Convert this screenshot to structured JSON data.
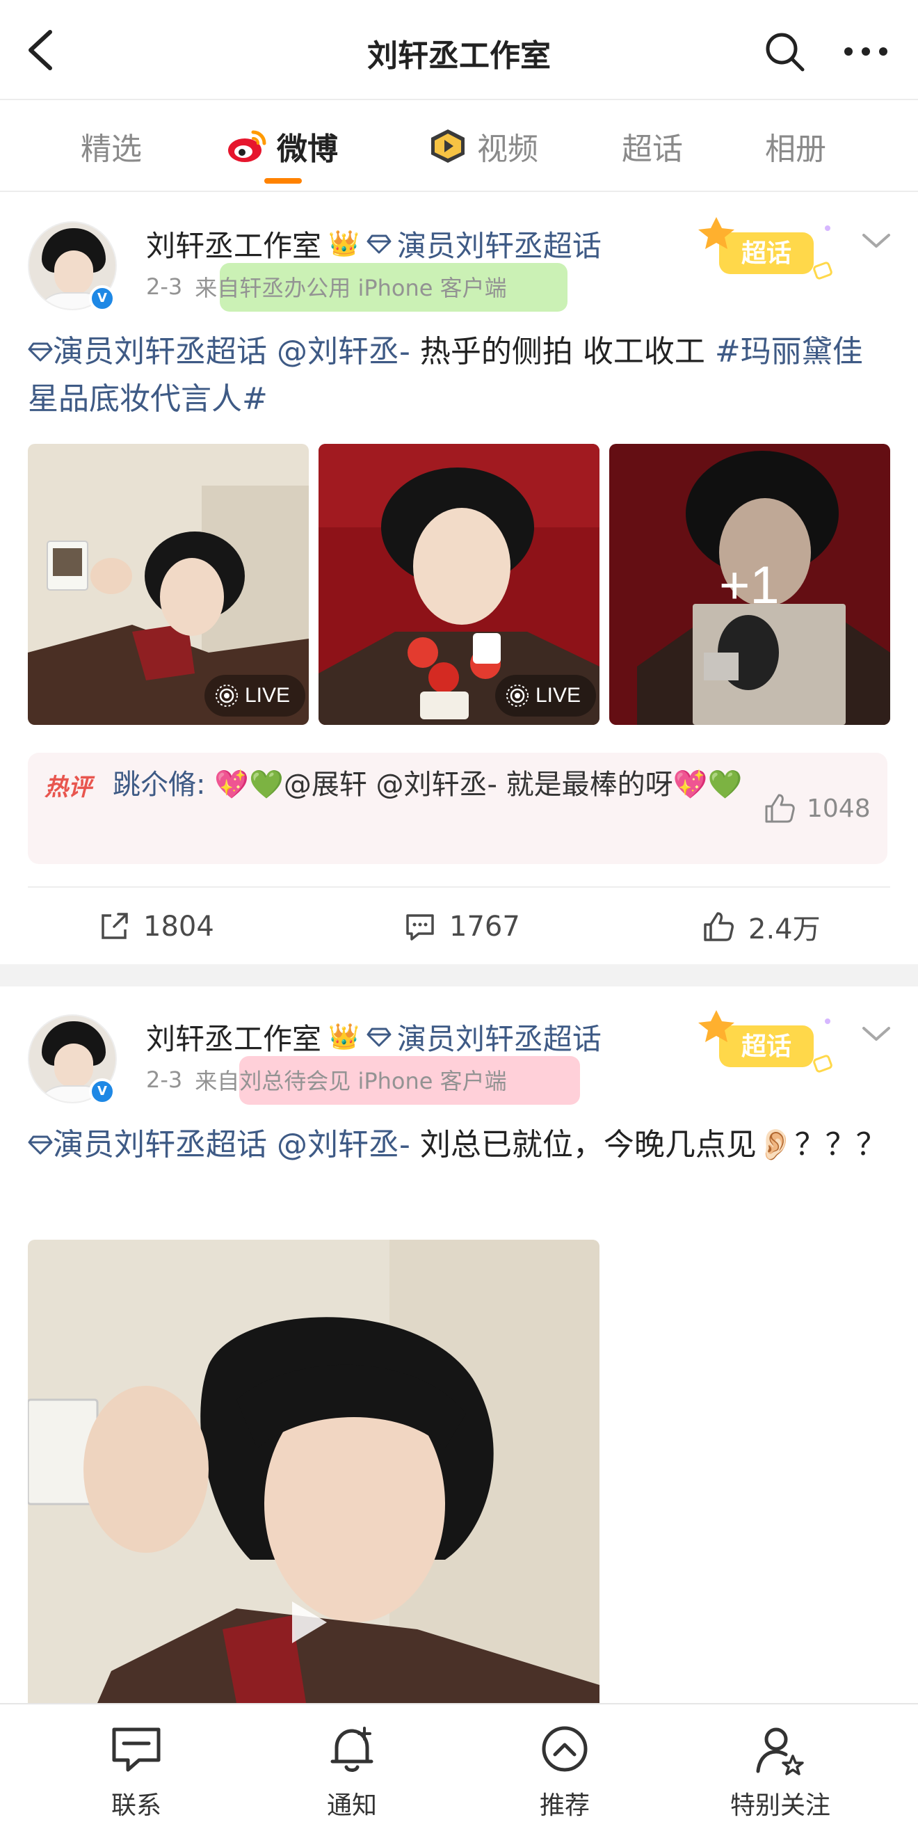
{
  "header": {
    "title": "刘轩丞工作室"
  },
  "tabs": [
    {
      "label": "精选"
    },
    {
      "label": "微博"
    },
    {
      "label": "视频"
    },
    {
      "label": "超话"
    },
    {
      "label": "相册"
    }
  ],
  "posts": [
    {
      "author": "刘轩丞工作室",
      "topic": "演员刘轩丞超话",
      "date": "2-3",
      "source": "来自轩丞办公用 iPhone 客户端",
      "text_topic": "演员刘轩丞超话",
      "text_mention": "@刘轩丞-",
      "text_body": " 热乎的侧拍 收工收工 ",
      "text_hashtag": "#玛丽黛佳星品底妆代言人#",
      "images": [
        {
          "badge": "LIVE"
        },
        {
          "badge": "LIVE"
        },
        {
          "overlay": "+1"
        }
      ],
      "hot_comment": {
        "badge": "热评",
        "author": "跳尒脩: ",
        "text": "💖💚@展轩 @刘轩丞- 就是最棒的呀💖💚",
        "likes": "1048"
      },
      "reposts": "1804",
      "comments": "1767",
      "likes": "2.4万"
    },
    {
      "author": "刘轩丞工作室",
      "topic": "演员刘轩丞超话",
      "date": "2-3",
      "source": "来自刘总待会见 iPhone 客户端",
      "text_topic": "演员刘轩丞超话",
      "text_mention": "@刘轩丞-",
      "text_body": " 刘总已就位，今晚几点见👂🏻？？？"
    }
  ],
  "supertopic_badge": "超话",
  "bottom_nav": [
    {
      "label": "联系",
      "icon": "chat-icon"
    },
    {
      "label": "通知",
      "icon": "bell-icon"
    },
    {
      "label": "推荐",
      "icon": "chevron-up-circle-icon"
    },
    {
      "label": "特别关注",
      "icon": "user-star-icon"
    }
  ],
  "colors": {
    "accent": "#ff8200",
    "link": "#3e5a85",
    "hot": "#e8554e"
  }
}
